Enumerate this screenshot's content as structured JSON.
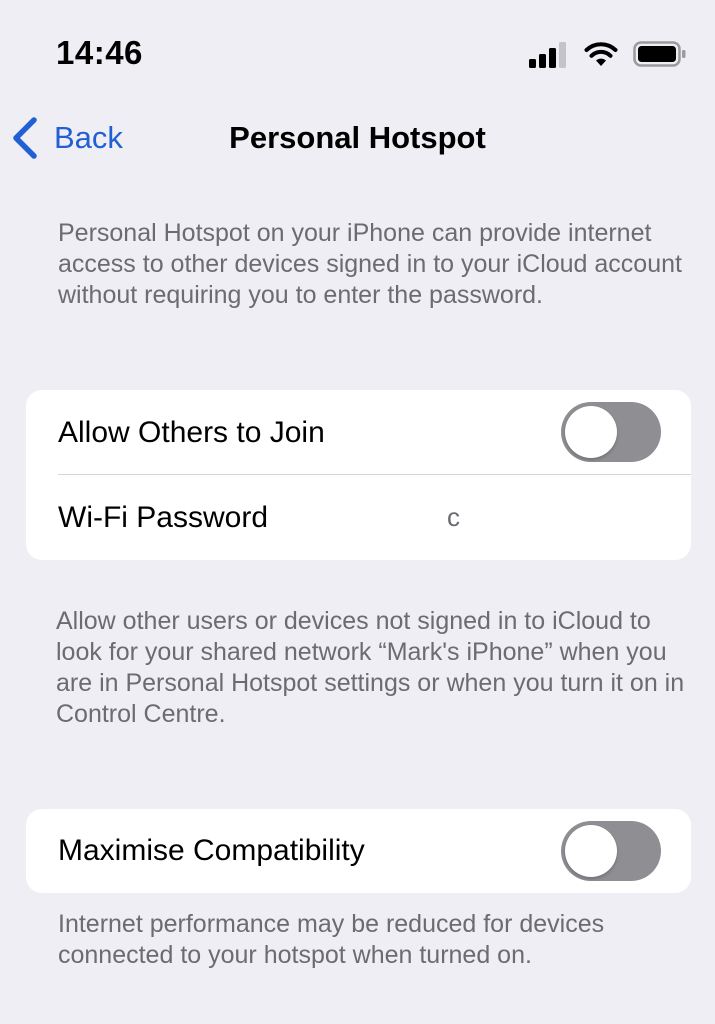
{
  "status_bar": {
    "time": "14:46",
    "icons": [
      "signal-icon",
      "wifi-icon",
      "battery-icon"
    ]
  },
  "nav": {
    "back_label": "Back",
    "title": "Personal Hotspot",
    "back_icon": "chevron-left-icon",
    "accent_color": "#2160d4"
  },
  "intro_note": "Personal Hotspot on your iPhone can provide internet access to other devices signed in to your iCloud account without requiring you to enter the password.",
  "group_network": {
    "allow_others": {
      "label": "Allow Others to Join",
      "enabled": false
    },
    "wifi_password": {
      "label": "Wi-Fi Password",
      "value": "c"
    }
  },
  "network_note": "Allow other users or devices not signed in to iCloud to look for your shared network “Mark's iPhone” when you are in Personal Hotspot settings or when you turn it on in Control Centre.",
  "group_compat": {
    "maximise_compatibility": {
      "label": "Maximise Compatibility",
      "enabled": false
    }
  },
  "compat_note": "Internet performance may be reduced for devices connected to your hotspot when turned on."
}
